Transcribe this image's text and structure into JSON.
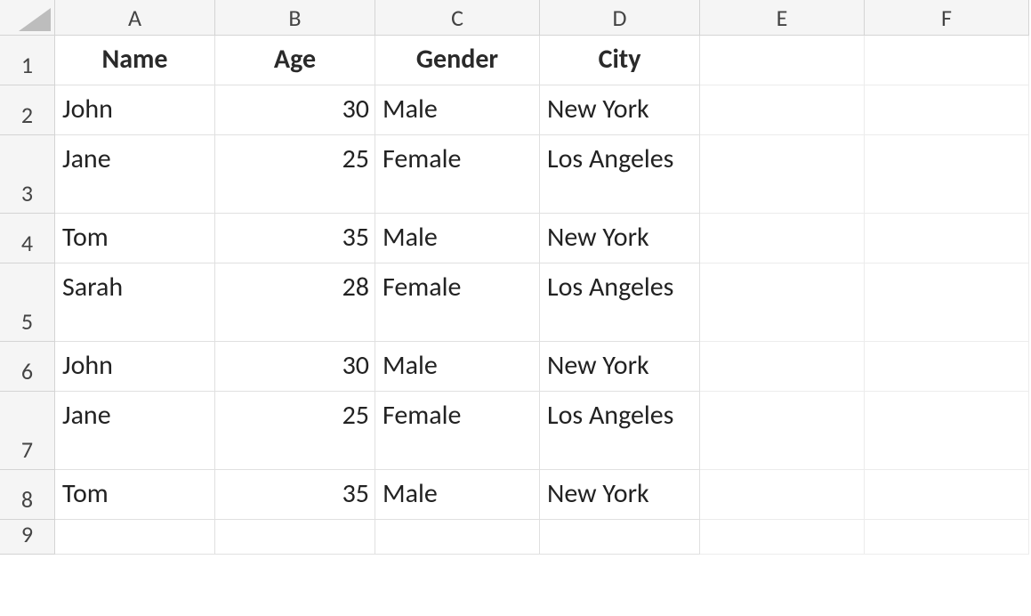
{
  "columns": [
    "A",
    "B",
    "C",
    "D",
    "E",
    "F"
  ],
  "row_numbers": [
    "1",
    "2",
    "3",
    "4",
    "5",
    "6",
    "7",
    "8",
    "9"
  ],
  "headers": {
    "name": "Name",
    "age": "Age",
    "gender": "Gender",
    "city": "City"
  },
  "rows": [
    {
      "name": "John",
      "age": "30",
      "gender": "Male",
      "city": "New York"
    },
    {
      "name": "Jane",
      "age": "25",
      "gender": "Female",
      "city": "Los Angeles"
    },
    {
      "name": "Tom",
      "age": "35",
      "gender": "Male",
      "city": "New York"
    },
    {
      "name": "Sarah",
      "age": "28",
      "gender": "Female",
      "city": "Los Angeles"
    },
    {
      "name": "John",
      "age": "30",
      "gender": "Male",
      "city": "New York"
    },
    {
      "name": "Jane",
      "age": "25",
      "gender": "Female",
      "city": "Los Angeles"
    },
    {
      "name": "Tom",
      "age": "35",
      "gender": "Male",
      "city": "New York"
    }
  ]
}
